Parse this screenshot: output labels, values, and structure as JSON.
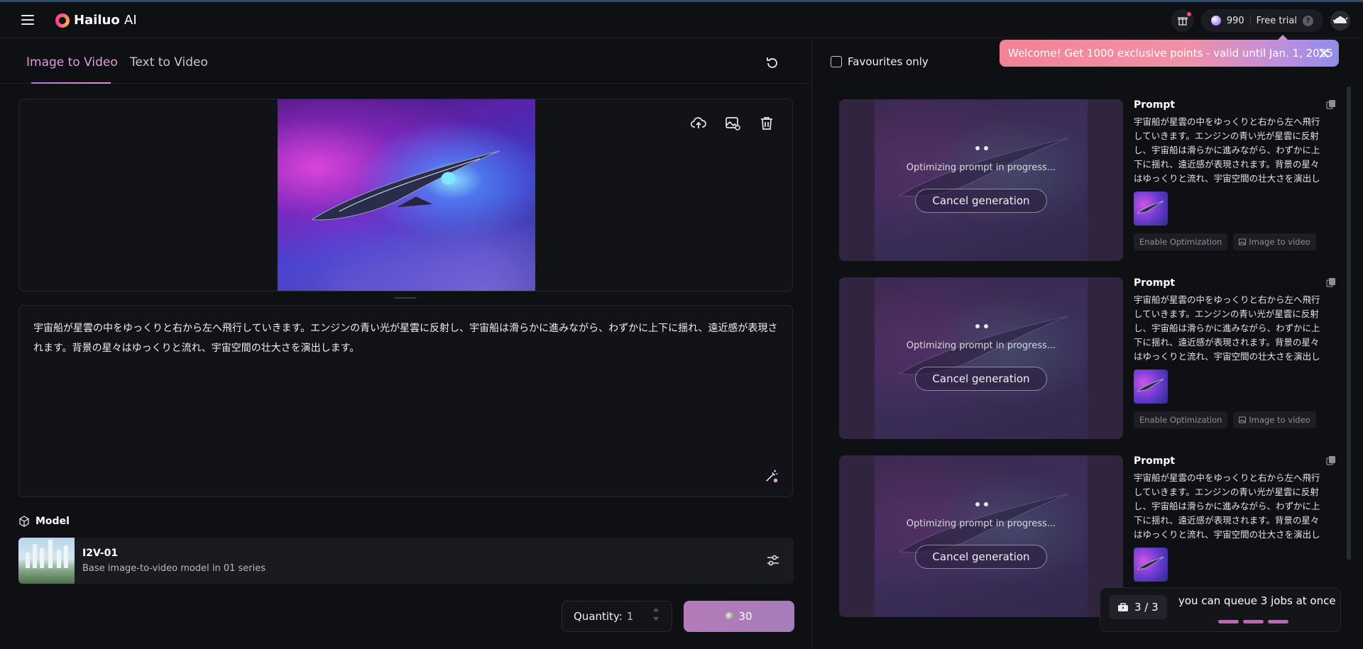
{
  "app": {
    "name": "Hailuo",
    "name_suffix": "AI",
    "points": "990",
    "plan_label": "Free trial",
    "help_glyph": "?"
  },
  "tabs": [
    {
      "label": "Image to Video",
      "active": true
    },
    {
      "label": "Text to Video",
      "active": false
    }
  ],
  "prompt": {
    "text": "宇宙船が星雲の中をゆっくりと右から左へ飛行していきます。エンジンの青い光が星雲に反射し、宇宙船は滑らかに進みながら、わずかに上下に揺れ、遠近感が表現されます。背景の星々はゆっくりと流れ、宇宙空間の壮大さを演出します。"
  },
  "model": {
    "section_label": "Model",
    "name": "I2V-01",
    "description": "Base image-to-video model in 01 series"
  },
  "quantity": {
    "label": "Quantity:",
    "value": "1"
  },
  "generate": {
    "cost": "30"
  },
  "history": {
    "favourites_label": "Favourites only",
    "welcome_banner": "Welcome! Get 1000 exclusive points - valid until Jan. 1, 2025",
    "jobs": [
      {
        "status_text": "Optimizing prompt in progress...",
        "cancel_label": "Cancel generation",
        "prompt_heading": "Prompt",
        "prompt_text": "宇宙船が星雲の中をゆっくりと右から左へ飛行していきます。エンジンの青い光が星雲に反射し、宇宙船は滑らかに進みながら、わずかに上下に揺れ、遠近感が表現されます。背景の星々はゆっくりと流れ、宇宙空間の壮大さを演出します。",
        "tags": [
          "Enable Optimization",
          "Image to video"
        ]
      },
      {
        "status_text": "Optimizing prompt in progress...",
        "cancel_label": "Cancel generation",
        "prompt_heading": "Prompt",
        "prompt_text": "宇宙船が星雲の中をゆっくりと右から左へ飛行していきます。エンジンの青い光が星雲に反射し、宇宙船は滑らかに進みながら、わずかに上下に揺れ、遠近感が表現されます。背景の星々はゆっくりと流れ、宇宙空間の壮大さを演出します。",
        "tags": [
          "Enable Optimization",
          "Image to video"
        ]
      },
      {
        "status_text": "Optimizing prompt in progress...",
        "cancel_label": "Cancel generation",
        "prompt_heading": "Prompt",
        "prompt_text": "宇宙船が星雲の中をゆっくりと右から左へ飛行していきます。エンジンの青い光が星雲に反射し、宇宙船は滑らかに進みながら、わずかに上下に揺れ、遠近感が表現されます。背景の星々はゆっくりと流れ、宇宙空間の壮大さを演出します。",
        "tags": []
      }
    ]
  },
  "queue": {
    "count": "3 / 3",
    "message": "you can queue 3 jobs at once"
  },
  "colors": {
    "accent_pink": "#e39ae0",
    "welcome_gradient_start": "#f38395",
    "generate_button": "#b57ab8"
  }
}
